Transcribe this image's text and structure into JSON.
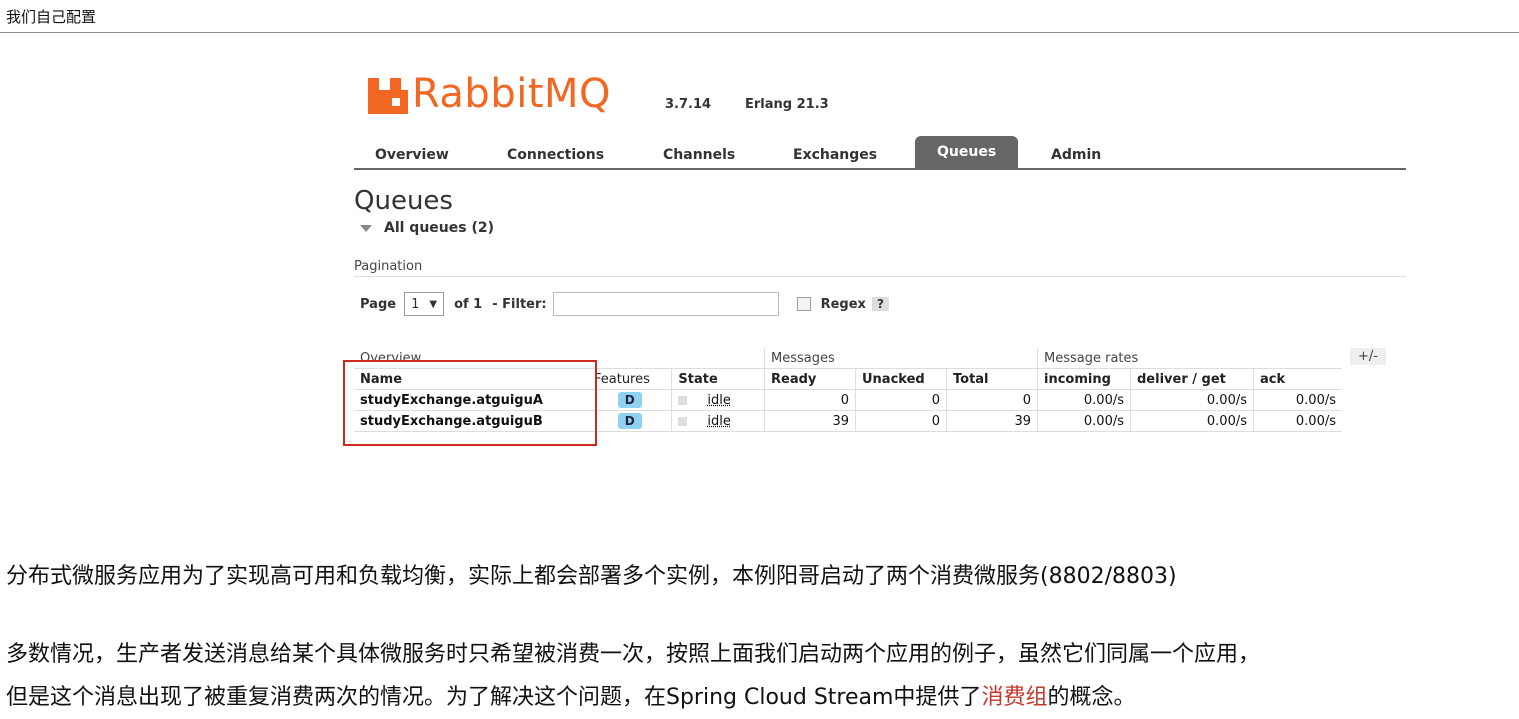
{
  "page": {
    "title": "我们自己配置"
  },
  "rabbitmq": {
    "brand": "RabbitMQ",
    "version": "3.7.14",
    "erlang": "Erlang 21.3",
    "tabs": [
      "Overview",
      "Connections",
      "Channels",
      "Exchanges",
      "Queues",
      "Admin"
    ],
    "active_tab": "Queues",
    "heading": "Queues",
    "all_queues": "All queues (2)",
    "pagination_label": "Pagination",
    "page_label": "Page",
    "page_value": "1",
    "of_label": "of 1",
    "filter_label": "- Filter:",
    "filter_value": "",
    "regex_label": "Regex",
    "help": "?",
    "plus_minus": "+/-",
    "groups": {
      "overview": "Overview",
      "messages": "Messages",
      "rates": "Message rates"
    },
    "columns": [
      "Name",
      "Features",
      "State",
      "Ready",
      "Unacked",
      "Total",
      "incoming",
      "deliver / get",
      "ack"
    ],
    "rows": [
      {
        "name": "studyExchange.atguiguA",
        "feature": "D",
        "state": "idle",
        "ready": "0",
        "unacked": "0",
        "total": "0",
        "incoming": "0.00/s",
        "deliver_get": "0.00/s",
        "ack": "0.00/s"
      },
      {
        "name": "studyExchange.atguiguB",
        "feature": "D",
        "state": "idle",
        "ready": "39",
        "unacked": "0",
        "total": "39",
        "incoming": "0.00/s",
        "deliver_get": "0.00/s",
        "ack": "0.00/s"
      }
    ]
  },
  "text": {
    "para1": "分布式微服务应用为了实现高可用和负载均衡，实际上都会部署多个实例，本例阳哥启动了两个消费微服务(8802/8803)",
    "para2": "多数情况，生产者发送消息给某个具体微服务时只希望被消费一次，按照上面我们启动两个应用的例子，虽然它们同属一个应用，",
    "para3_a": "但是这个消息出现了被重复消费两次的情况。为了解决这个问题，在Spring Cloud Stream中提供了",
    "para3_hl": "消费组",
    "para3_b": "的概念。"
  },
  "colors": {
    "brand": "#f26722",
    "highlight_box": "#cc2a1f",
    "highlight_text": "#c0392b"
  }
}
